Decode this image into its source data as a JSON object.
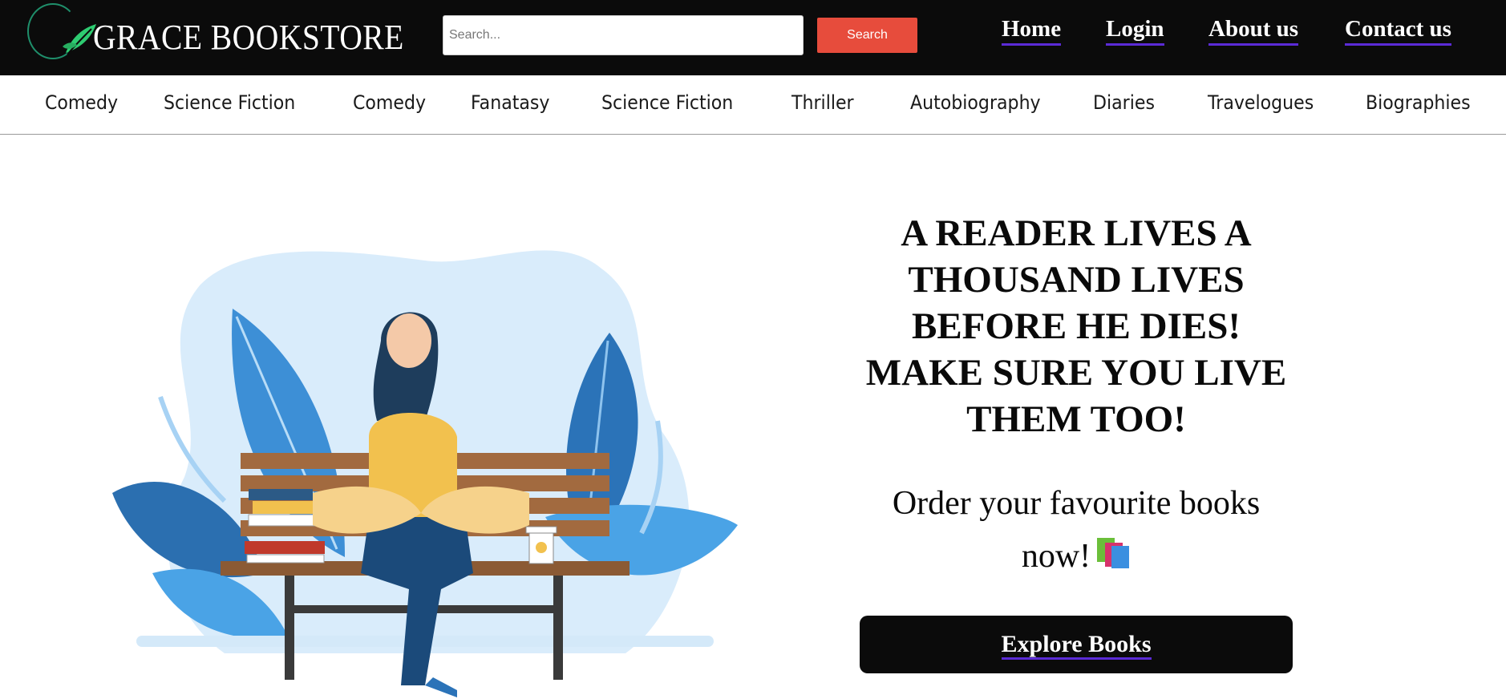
{
  "header": {
    "brand": "GRACE BOOKSTORE",
    "search": {
      "placeholder": "Search...",
      "button_label": "Search"
    },
    "nav": [
      "Home",
      "Login",
      "About us",
      "Contact us"
    ]
  },
  "categories": [
    "Comedy",
    "Science Fiction",
    "Comedy",
    "Fanatasy",
    "Science Fiction",
    "Thriller",
    "Autobiography",
    "Diaries",
    "Travelogues",
    "Biographies"
  ],
  "hero": {
    "headline": "A READER LIVES A THOUSAND LIVES BEFORE HE DIES! MAKE SURE YOU LIVE THEM TOO!",
    "subtext": "Order your favourite books now!",
    "cta_label": "Explore Books",
    "illustration_icon": "woman-reading-on-bench-illustration",
    "emoji_icon": "books-icon"
  },
  "colors": {
    "header_bg": "#0b0b0b",
    "search_button": "#e74c3c",
    "link_underline": "#5b2bd6",
    "illustration_blue": "#3d8fd6",
    "illustration_light_blue": "#d9ecfb"
  }
}
